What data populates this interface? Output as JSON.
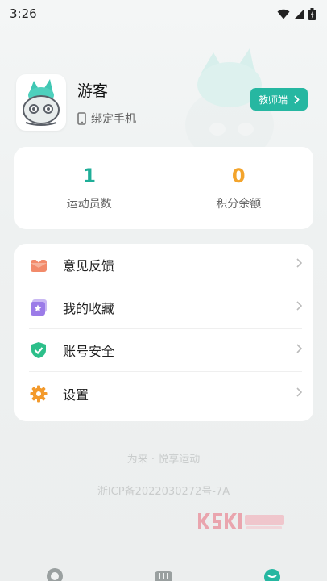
{
  "status_bar": {
    "time": "3:26"
  },
  "profile": {
    "username": "游客",
    "bind_phone": "绑定手机"
  },
  "teacher_button": {
    "label": "教师端"
  },
  "stats": [
    {
      "value": "1",
      "label": "运动员数",
      "color": "#1fae98"
    },
    {
      "value": "0",
      "label": "积分余额",
      "color": "#f3a42c"
    }
  ],
  "menu": [
    {
      "label": "意见反馈",
      "icon": "feedback-envelope-icon"
    },
    {
      "label": "我的收藏",
      "icon": "favorites-star-icon"
    },
    {
      "label": "账号安全",
      "icon": "shield-check-icon"
    },
    {
      "label": "设置",
      "icon": "gear-icon"
    }
  ],
  "footer": {
    "slogan": "为来 · 悦享运动",
    "icp": "浙ICP备2022030272号-7A"
  },
  "colors": {
    "accent": "#26b7a1"
  }
}
